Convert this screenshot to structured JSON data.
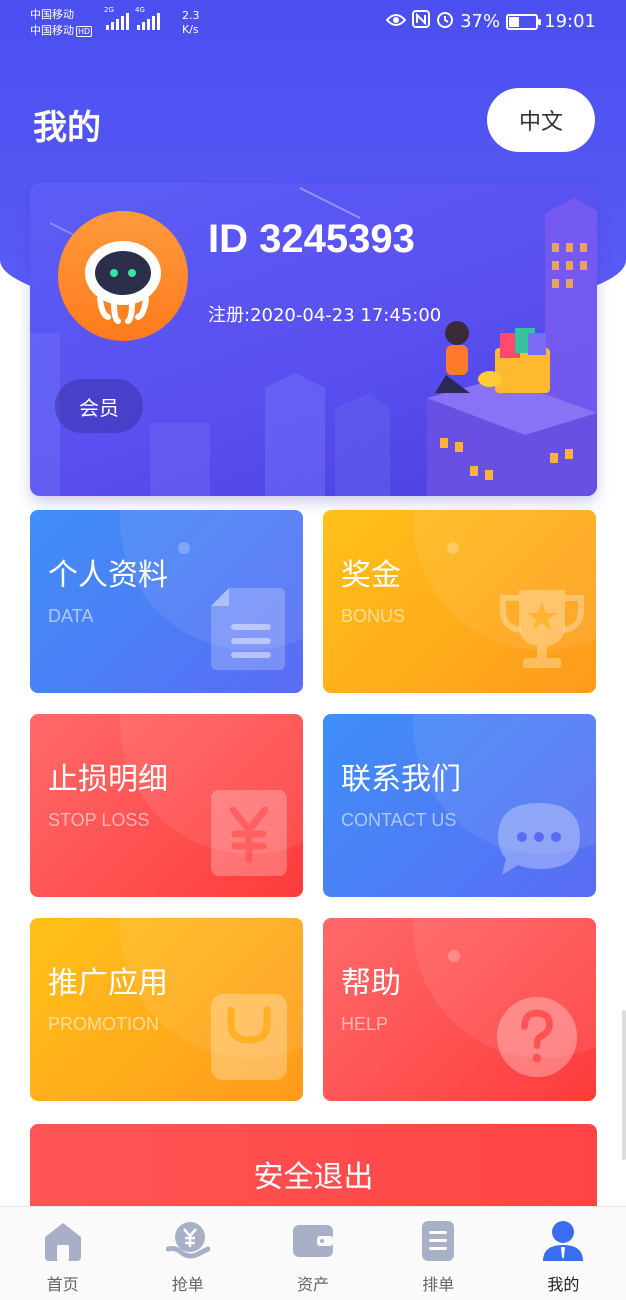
{
  "status_bar": {
    "carrier1": "中国移动",
    "carrier2": "中国移动",
    "hd_badge": "HD",
    "net1": "2G",
    "net2": "4G",
    "speed_value": "2.3",
    "speed_unit": "K/s",
    "battery": "37%",
    "time": "19:01"
  },
  "header": {
    "title": "我的",
    "language_button": "中文"
  },
  "profile": {
    "user_id": "ID 3245393",
    "register_time": "注册:2020-04-23 17:45:00",
    "member_label": "会员"
  },
  "tiles": [
    {
      "title": "个人资料",
      "subtitle": "DATA",
      "icon": "document-icon"
    },
    {
      "title": "奖金",
      "subtitle": "BONUS",
      "icon": "trophy-icon"
    },
    {
      "title": "止损明细",
      "subtitle": "STOP LOSS",
      "icon": "yuan-icon"
    },
    {
      "title": "联系我们",
      "subtitle": "CONTACT US",
      "icon": "chat-bubble-icon"
    },
    {
      "title": "推广应用",
      "subtitle": "PROMOTION",
      "icon": "shopping-bag-icon"
    },
    {
      "title": "帮助",
      "subtitle": "HELP",
      "icon": "question-icon"
    }
  ],
  "logout_button": "安全退出",
  "tabbar": {
    "items": [
      {
        "label": "首页",
        "icon": "home-icon",
        "active": false
      },
      {
        "label": "抢单",
        "icon": "grab-order-icon",
        "active": false
      },
      {
        "label": "资产",
        "icon": "wallet-icon",
        "active": false
      },
      {
        "label": "排单",
        "icon": "list-icon",
        "active": false
      },
      {
        "label": "我的",
        "icon": "user-icon",
        "active": true
      }
    ],
    "colors": {
      "inactive": "#a8b0c8",
      "active": "#3b6df0"
    }
  },
  "colors": {
    "header": "#4b4ff0",
    "blue_tile": "#4a7ff6",
    "orange_tile": "#ffad1a",
    "red_tile": "#ff4a4a"
  }
}
